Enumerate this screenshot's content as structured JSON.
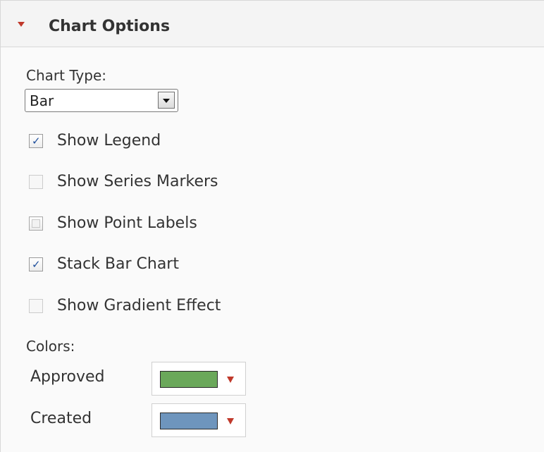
{
  "panel": {
    "title": "Chart Options",
    "expanded": true
  },
  "chart_type": {
    "label": "Chart Type:",
    "selected": "Bar"
  },
  "options": [
    {
      "label": "Show Legend",
      "checked": true,
      "enabled": true
    },
    {
      "label": "Show Series Markers",
      "checked": false,
      "enabled": false
    },
    {
      "label": "Show Point Labels",
      "checked": false,
      "enabled": true
    },
    {
      "label": "Stack Bar Chart",
      "checked": true,
      "enabled": true
    },
    {
      "label": "Show Gradient Effect",
      "checked": false,
      "enabled": false
    }
  ],
  "colors": {
    "label": "Colors:",
    "series": [
      {
        "name": "Approved",
        "color": "#6aa85a"
      },
      {
        "name": "Created",
        "color": "#6e95bd"
      }
    ]
  },
  "theme": {
    "accent_caret": "#c0392b",
    "checkmark": "#1f4f9c"
  }
}
